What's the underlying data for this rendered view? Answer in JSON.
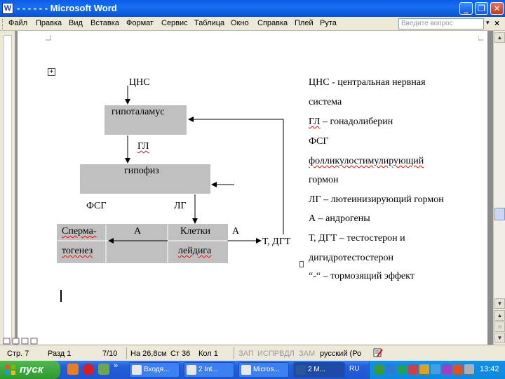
{
  "window": {
    "title": "- - - - -  - Microsoft Word",
    "app_icon": "W",
    "minimize": "_",
    "restore": "❐",
    "close": "✕"
  },
  "menu": {
    "items": [
      "Файл",
      "Правка",
      "Вид",
      "Вставка",
      "Формат",
      "Сервис",
      "Таблица",
      "Окно",
      "Справка",
      "Плей",
      "Рута"
    ],
    "ask_placeholder": "Введите вопрос",
    "ask_arrow": "▾",
    "doc_close": "×"
  },
  "diagram": {
    "plus": "+",
    "cns": "ЦНС",
    "hypothalamus": "гипоталамус",
    "gl": "ГЛ",
    "pituitary": "гипофиз",
    "fsg": "ФСГ",
    "lg": "ЛГ",
    "sperma_1": "Сперма-",
    "sperma_2": "тогенез",
    "a_mid": "А",
    "leydig_1": "Клетки",
    "leydig_2": "лейдига",
    "a_right": "А",
    "t_dgt": "Т, ДГТ"
  },
  "legend": [
    {
      "abbr": "ЦНС",
      "text": " - центральная нервная"
    },
    {
      "abbr": "",
      "text": "система"
    },
    {
      "abbr": "ГЛ",
      "text": " – гонадолиберин"
    },
    {
      "abbr": "ФСГ",
      "text": " – "
    },
    {
      "abbr": "",
      "text": "фолликулостимулирующий"
    },
    {
      "abbr": "",
      "text": "гормон"
    },
    {
      "abbr": "ЛГ",
      "text": " – лютеинизирующий гормон"
    },
    {
      "abbr": "А",
      "text": " – андрогены"
    },
    {
      "abbr": "Т, ДГТ",
      "text": " – тестостерон и"
    },
    {
      "abbr": "",
      "text": "дигидротестостерон"
    },
    {
      "abbr": "“-“",
      "text": " – тормозящий эффект"
    }
  ],
  "scrollbar": {
    "up": "▲",
    "down": "▼",
    "prev": "▲",
    "select": "○",
    "next": "▼"
  },
  "status": {
    "page": "Стр. 7",
    "section": "Разд 1",
    "pages": "7/10",
    "at": "На 26,8см",
    "line": "Ст 36",
    "col": "Кол 1",
    "rec": "ЗАП",
    "trk": "ИСПР",
    "ext": "ВДЛ",
    "ovr": "ЗАМ",
    "lang": "русский (Ро",
    "spell_icon": "book-check-icon"
  },
  "taskbar": {
    "start": "пуск",
    "more": "»",
    "tasks": [
      {
        "label": "Входя...",
        "active": false
      },
      {
        "label": "2 Int...",
        "active": false
      },
      {
        "label": "Micros...",
        "active": false
      },
      {
        "label": "2 M...",
        "active": true
      }
    ],
    "lang": "RU",
    "clock": "13:42"
  },
  "colors": {
    "title_blue": "#0a5de8",
    "box_gray": "#c0c0c0",
    "spell_red": "#d01010"
  }
}
